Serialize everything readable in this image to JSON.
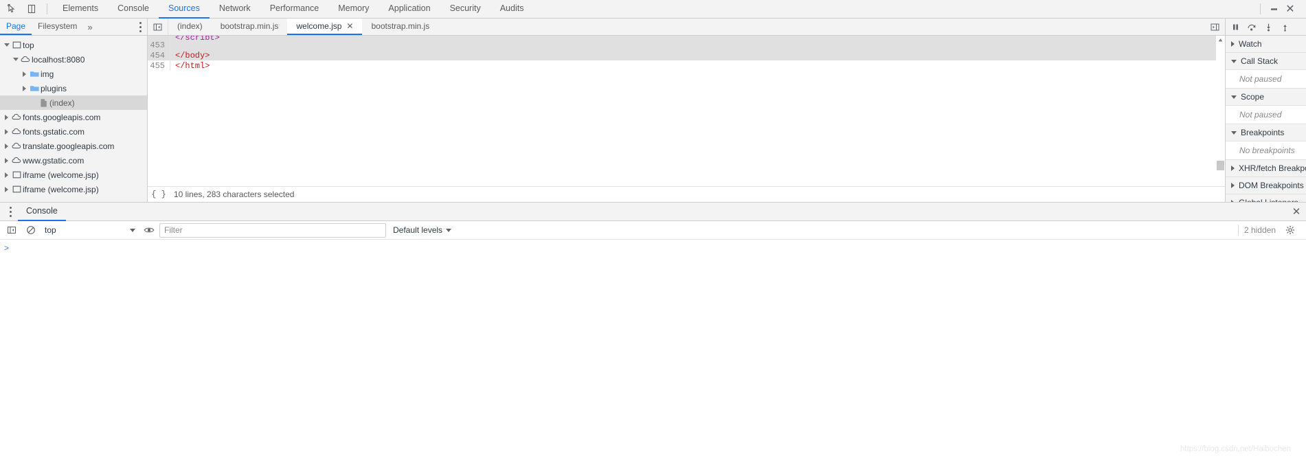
{
  "main_toolbar": {
    "inspect_icon": "inspect-cursor-icon",
    "device_icon": "device-toolbar-icon",
    "tabs": [
      {
        "label": "Elements",
        "active": false
      },
      {
        "label": "Console",
        "active": false
      },
      {
        "label": "Sources",
        "active": true
      },
      {
        "label": "Network",
        "active": false
      },
      {
        "label": "Performance",
        "active": false
      },
      {
        "label": "Memory",
        "active": false
      },
      {
        "label": "Application",
        "active": false
      },
      {
        "label": "Security",
        "active": false
      },
      {
        "label": "Audits",
        "active": false
      }
    ],
    "kebab_icon": "more-options-icon",
    "close_icon": "close-devtools-icon",
    "accent_color": "#1a73e8"
  },
  "navigator": {
    "tabs": [
      {
        "label": "Page",
        "active": true
      },
      {
        "label": "Filesystem",
        "active": false
      }
    ],
    "more_label": "»",
    "kebab_icon": "navigator-more-options-icon",
    "tree": [
      {
        "label": "top",
        "indent": 0,
        "twisty": "down",
        "icon": "frame-icon",
        "selected": false,
        "dim": false
      },
      {
        "label": "localhost:8080",
        "indent": 1,
        "twisty": "down",
        "icon": "cloud-icon",
        "selected": false,
        "dim": false
      },
      {
        "label": "img",
        "indent": 2,
        "twisty": "right",
        "icon": "folder-icon",
        "selected": false,
        "dim": false
      },
      {
        "label": "plugins",
        "indent": 2,
        "twisty": "right",
        "icon": "folder-icon",
        "selected": false,
        "dim": false
      },
      {
        "label": "(index)",
        "indent": 3,
        "twisty": "none",
        "icon": "document-icon",
        "selected": true,
        "dim": true
      },
      {
        "label": "fonts.googleapis.com",
        "indent": 0,
        "twisty": "right",
        "icon": "cloud-icon",
        "selected": false,
        "dim": false
      },
      {
        "label": "fonts.gstatic.com",
        "indent": 0,
        "twisty": "right",
        "icon": "cloud-icon",
        "selected": false,
        "dim": false
      },
      {
        "label": "translate.googleapis.com",
        "indent": 0,
        "twisty": "right",
        "icon": "cloud-icon",
        "selected": false,
        "dim": false
      },
      {
        "label": "www.gstatic.com",
        "indent": 0,
        "twisty": "right",
        "icon": "cloud-icon",
        "selected": false,
        "dim": false
      },
      {
        "label": "iframe (welcome.jsp)",
        "indent": 0,
        "twisty": "right",
        "icon": "frame-icon",
        "selected": false,
        "dim": false
      },
      {
        "label": "iframe (welcome.jsp)",
        "indent": 0,
        "twisty": "right",
        "icon": "frame-icon",
        "selected": false,
        "dim": false
      }
    ]
  },
  "editor": {
    "show_navigator_icon": "show-navigator-icon",
    "more_tabs_icon": "more-tabs-icon",
    "tabs": [
      {
        "label": "(index)",
        "active": false,
        "closable": false
      },
      {
        "label": "bootstrap.min.js",
        "active": false,
        "closable": false
      },
      {
        "label": "welcome.jsp",
        "active": true,
        "closable": true
      },
      {
        "label": "bootstrap.min.js",
        "active": false,
        "closable": false
      }
    ],
    "tab_close_glyph": "✕",
    "lines": [
      {
        "number": "453",
        "text": "",
        "selected": true
      },
      {
        "number": "454",
        "text": "</body>",
        "selected": true
      },
      {
        "number": "455",
        "text": "</html>",
        "selected": false
      }
    ],
    "status": {
      "braces": "{ }",
      "text": "10 lines, 283 characters selected"
    }
  },
  "debugger_sidebar": {
    "toolbar": {
      "pause_icon": "pause-script-icon",
      "step_over_icon": "step-over-icon",
      "step_into_icon": "step-into-icon",
      "step_out_icon": "step-out-icon"
    },
    "sections": [
      {
        "title": "Watch",
        "expanded": false,
        "body": null
      },
      {
        "title": "Call Stack",
        "expanded": true,
        "body": "Not paused"
      },
      {
        "title": "Scope",
        "expanded": true,
        "body": "Not paused"
      },
      {
        "title": "Breakpoints",
        "expanded": true,
        "body": "No breakpoints"
      },
      {
        "title": "XHR/fetch Breakpoints",
        "expanded": false,
        "body": null
      },
      {
        "title": "DOM Breakpoints",
        "expanded": false,
        "body": null
      },
      {
        "title": "Global Listeners",
        "expanded": false,
        "body": null
      }
    ]
  },
  "drawer": {
    "kebab_icon": "drawer-more-options-icon",
    "tabs": [
      {
        "label": "Console",
        "active": true
      }
    ],
    "close_icon": "close-drawer-icon",
    "toolbar": {
      "sidebar_icon": "console-sidebar-icon",
      "clear_icon": "clear-console-icon",
      "eye_icon": "live-expression-icon",
      "context_value": "top",
      "filter_placeholder": "Filter",
      "filter_value": "",
      "levels_label": "Default levels",
      "levels_caret": "▾",
      "hidden_label": "2 hidden",
      "settings_icon": "console-settings-icon"
    },
    "prompt_glyph": ">"
  },
  "watermark": "https://blog.csdn.net/Haibochen"
}
